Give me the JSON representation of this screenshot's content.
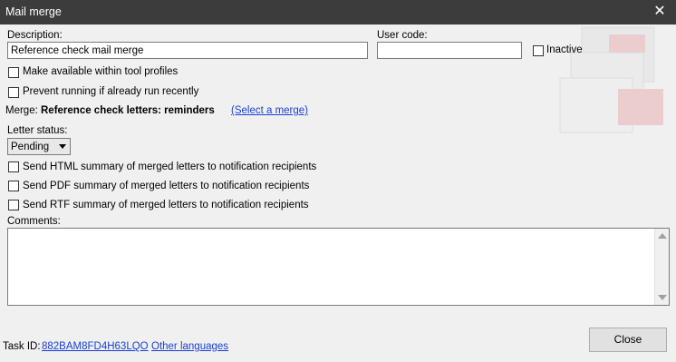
{
  "window": {
    "title": "Mail merge"
  },
  "form": {
    "description_label": "Description:",
    "description_value": "Reference check mail merge",
    "user_code_label": "User code:",
    "user_code_value": "",
    "inactive_label": "Inactive",
    "make_available_label": "Make available within tool profiles",
    "prevent_running_label": "Prevent running if already run recently",
    "merge_prefix": "Merge:",
    "merge_name": "Reference check letters: reminders",
    "select_merge_link": "(Select a merge)",
    "letter_status_label": "Letter status:",
    "letter_status_value": "Pending",
    "send_html_label": "Send HTML summary of merged letters to notification recipients",
    "send_pdf_label": "Send PDF summary of merged letters to notification recipients",
    "send_rtf_label": "Send RTF summary of merged letters to notification recipients",
    "comments_label": "Comments:",
    "comments_value": ""
  },
  "footer": {
    "task_id_label": "Task ID:",
    "task_id_value": "882BAM8FD4H63LQO",
    "other_languages_link": "Other languages",
    "close_button": "Close"
  },
  "icons": {
    "close": "close-icon",
    "decoration": "mail-envelopes-icon",
    "dropdown": "chevron-down-icon"
  },
  "colors": {
    "titlebar": "#3c3c3c",
    "link": "#1a3fd6",
    "background": "#f0f0f0"
  }
}
